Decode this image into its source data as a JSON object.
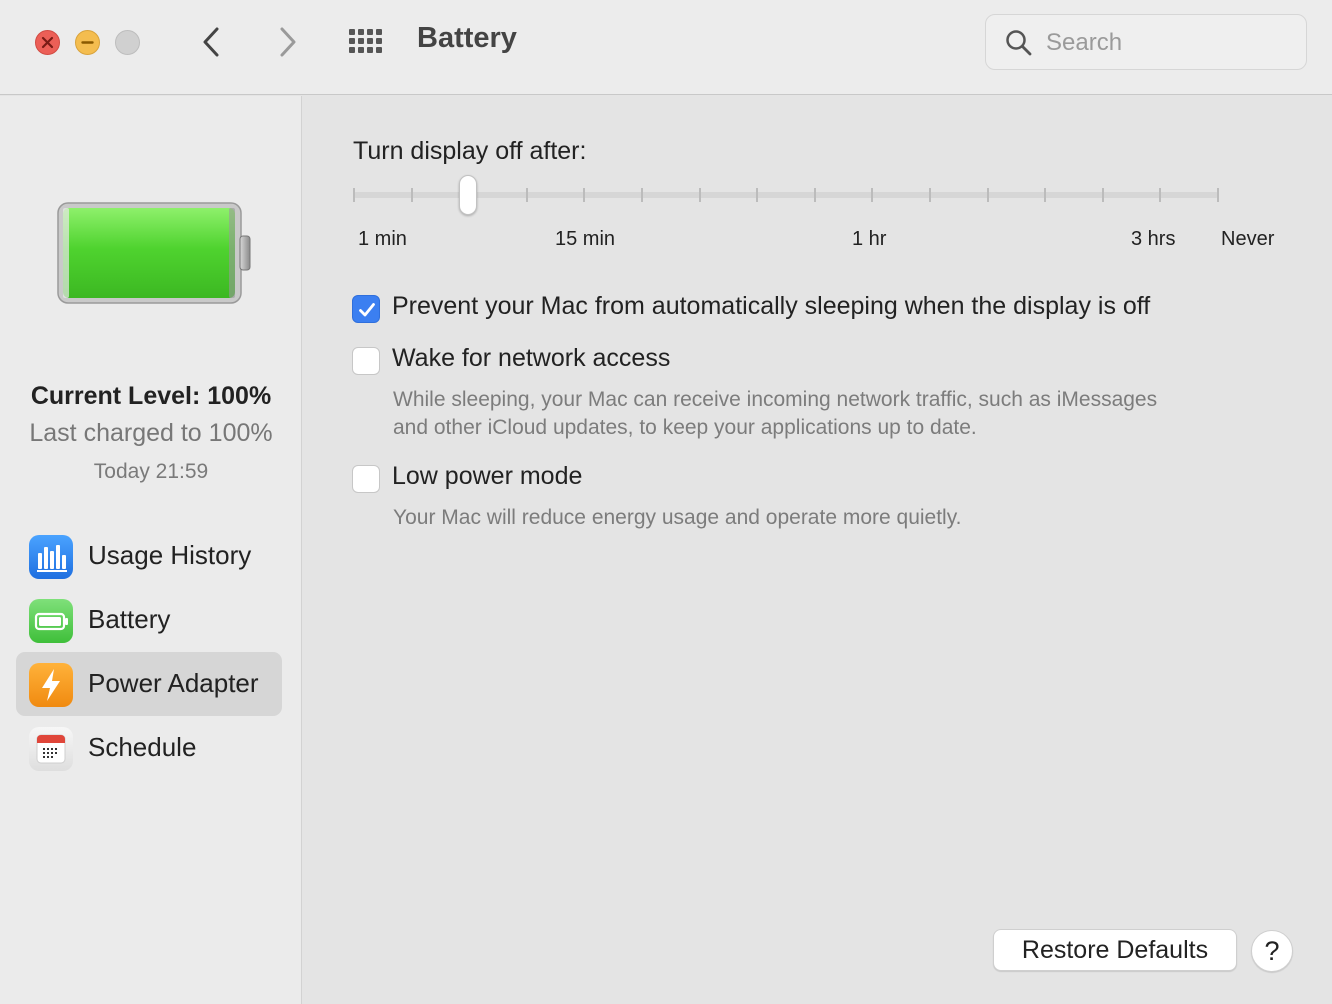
{
  "window": {
    "title": "Battery"
  },
  "toolbar": {
    "back_icon": "chevron-left-icon",
    "forward_icon": "chevron-right-icon",
    "grid_icon": "grid-icon"
  },
  "search": {
    "placeholder": "Search",
    "value": ""
  },
  "sidebar": {
    "current_level": "Current Level: 100%",
    "last_charged": "Last charged to 100%",
    "charged_time": "Today 21:59",
    "battery_fill": 1.0,
    "items": [
      {
        "label": "Usage History",
        "icon": "bar-chart-icon",
        "selected": false
      },
      {
        "label": "Battery",
        "icon": "battery-icon",
        "selected": false
      },
      {
        "label": "Power Adapter",
        "icon": "lightning-icon",
        "selected": true
      },
      {
        "label": "Schedule",
        "icon": "calendar-icon",
        "selected": false
      }
    ]
  },
  "display_slider": {
    "label": "Turn display off after:",
    "tick_labels": [
      "1 min",
      "15 min",
      "1 hr",
      "3 hrs",
      "Never"
    ],
    "tick_count": 16,
    "selected_tick_index": 2
  },
  "options": [
    {
      "label": "Prevent your Mac from automatically sleeping when the display is off",
      "checked": true
    },
    {
      "label": "Wake for network access",
      "checked": false,
      "description": [
        "While sleeping, your Mac can receive incoming network traffic, such as iMessages",
        "and other iCloud updates, to keep your applications up to date."
      ]
    },
    {
      "label": "Low power mode",
      "checked": false,
      "description": [
        "Your Mac will reduce energy usage and operate more quietly."
      ]
    }
  ],
  "footer": {
    "restore_label": "Restore Defaults",
    "help_label": "?"
  },
  "colors": {
    "accent": "#3b7ff1",
    "battery_green": "#4cd137"
  }
}
